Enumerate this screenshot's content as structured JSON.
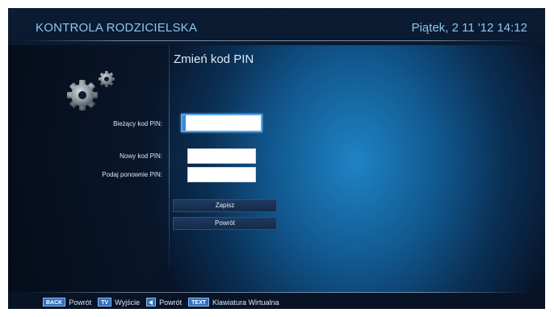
{
  "header": {
    "app_title": "KONTROLA RODZICIELSKA",
    "datetime": "Piątek, 2 11 '12 14:12"
  },
  "main": {
    "title": "Zmień kod PIN",
    "fields": [
      {
        "label": "Bieżący kod PIN:",
        "value": ""
      },
      {
        "label": "Nowy kod PIN:",
        "value": ""
      },
      {
        "label": "Podaj ponownie PIN:",
        "value": ""
      }
    ],
    "buttons": {
      "save": "Zapisz",
      "back": "Powrót"
    }
  },
  "footer": {
    "hints": [
      {
        "key": "BACK",
        "label": "Powrót"
      },
      {
        "key": "TV",
        "label": "Wyjście"
      },
      {
        "key": "arrow-left-icon",
        "label": "Powrót"
      },
      {
        "key": "TEXT",
        "label": "Klawiatura Wirtualna"
      }
    ]
  },
  "colors": {
    "header_text": "#8fc4ee",
    "focus_border": "#5aa6ea",
    "key_badge": "#2f6fc4"
  }
}
